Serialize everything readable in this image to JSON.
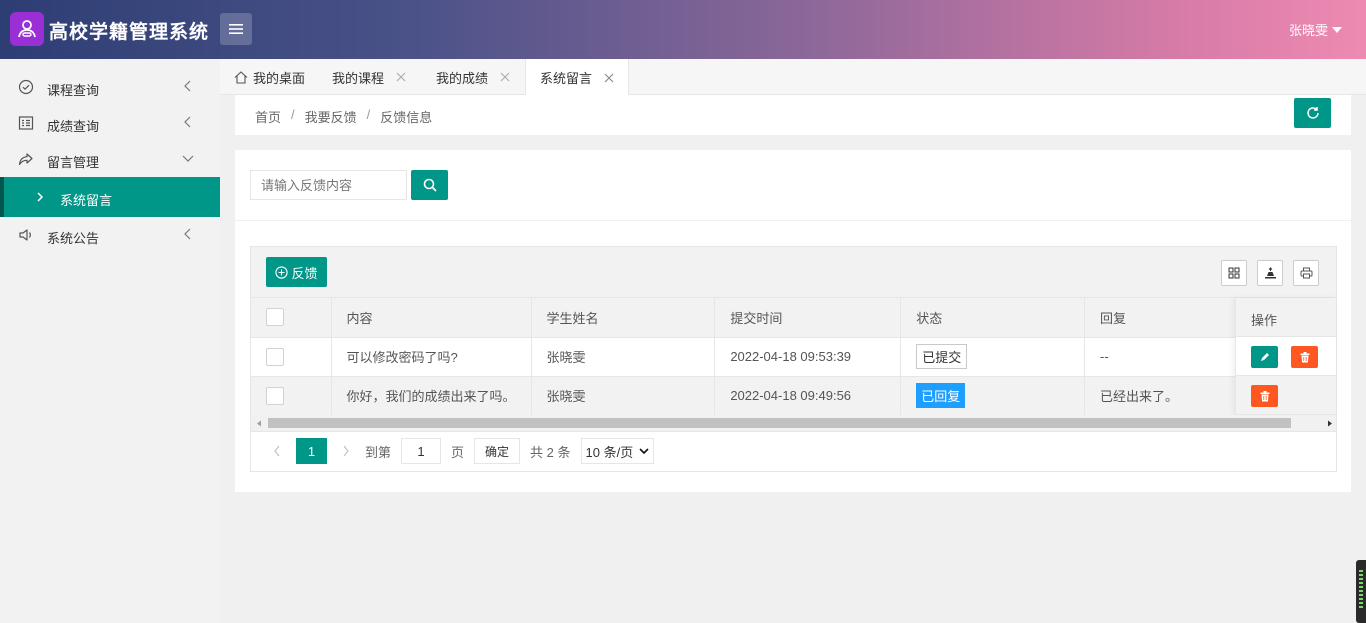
{
  "app": {
    "title": "高校学籍管理系统",
    "user": "张晓雯"
  },
  "sidebar": {
    "items": [
      {
        "label": "课程查询"
      },
      {
        "label": "成绩查询"
      },
      {
        "label": "留言管理"
      },
      {
        "label": "系统留言"
      },
      {
        "label": "系统公告"
      }
    ]
  },
  "tabs": [
    {
      "label": "我的桌面"
    },
    {
      "label": "我的课程"
    },
    {
      "label": "我的成绩"
    },
    {
      "label": "系统留言"
    }
  ],
  "breadcrumb": {
    "home": "首页",
    "level2": "我要反馈",
    "current": "反馈信息",
    "sep": "/"
  },
  "search": {
    "placeholder": "请输入反馈内容"
  },
  "toolbar": {
    "add_label": "反馈"
  },
  "table": {
    "headers": {
      "content": "内容",
      "student": "学生姓名",
      "time": "提交时间",
      "status": "状态",
      "reply": "回复",
      "ops": "操作"
    },
    "rows": [
      {
        "content": "可以修改密码了吗?",
        "student": "张晓雯",
        "time": "2022-04-18 09:53:39",
        "status": "已提交",
        "reply": "--"
      },
      {
        "content": "你好，我们的成绩出来了吗。",
        "student": "张晓雯",
        "time": "2022-04-18 09:49:56",
        "status": "已回复",
        "reply": "已经出来了。"
      }
    ]
  },
  "pager": {
    "current": "1",
    "goto_label": "到第",
    "goto_value": "1",
    "page_label": "页",
    "confirm": "确定",
    "total": "共 2 条",
    "page_size": "10 条/页"
  },
  "colors": {
    "accent": "#009688",
    "danger": "#ff5722",
    "info": "#1e9fff"
  }
}
